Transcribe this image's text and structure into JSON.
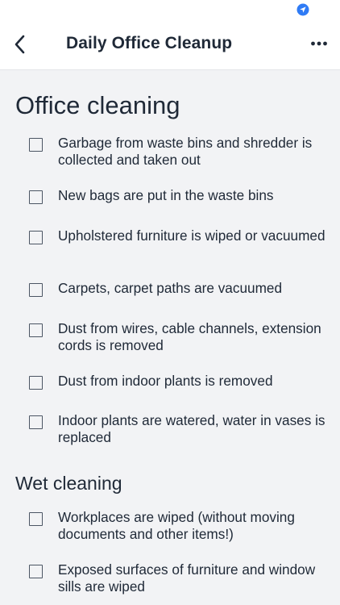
{
  "nav": {
    "title": "Daily Office Cleanup"
  },
  "icons": {
    "back": "chevron-left-icon",
    "more": "more-horizontal-icon",
    "location": "location-arrow-icon"
  },
  "colors": {
    "accent": "#2f7bf5",
    "text": "#1f2937",
    "background": "#f2f3f5"
  },
  "sections": [
    {
      "title": "Office cleaning",
      "items": [
        {
          "label": "Garbage from waste bins and shredder is collected and taken out",
          "checked": false
        },
        {
          "label": "New bags are put in the waste bins",
          "checked": false
        },
        {
          "label": "Upholstered furniture is wiped or vacuumed",
          "checked": false
        },
        {
          "label": "Carpets, carpet paths are vacuumed",
          "checked": false
        },
        {
          "label": "Dust from wires, cable channels, extension cords is removed",
          "checked": false
        },
        {
          "label": "Dust from indoor plants is removed",
          "checked": false
        },
        {
          "label": "Indoor plants are watered, water in vases is replaced",
          "checked": false
        }
      ]
    },
    {
      "title": "Wet cleaning",
      "items": [
        {
          "label": "Workplaces are wiped (without moving documents and other items!)",
          "checked": false
        },
        {
          "label": "Exposed surfaces of furniture and window sills are wiped",
          "checked": false
        }
      ]
    }
  ]
}
